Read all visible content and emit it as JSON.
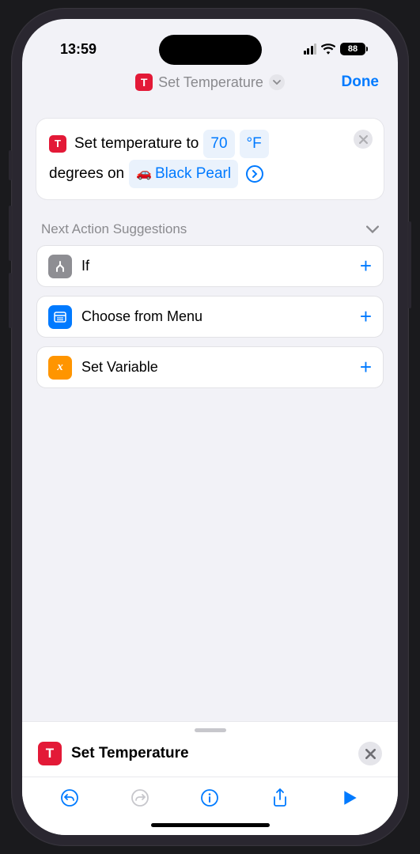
{
  "status": {
    "time": "13:59",
    "battery": "88"
  },
  "nav": {
    "title": "Set Temperature",
    "done": "Done"
  },
  "action": {
    "text_prefix": "Set temperature to",
    "temp_value": "70",
    "temp_unit": "°F",
    "degrees_on": "degrees on",
    "vehicle": "Black Pearl"
  },
  "suggestions_header": "Next Action Suggestions",
  "suggestions": [
    {
      "label": "If",
      "icon_color": "gray",
      "icon_glyph": "Y"
    },
    {
      "label": "Choose from Menu",
      "icon_color": "blue",
      "icon_glyph": "▤"
    },
    {
      "label": "Set Variable",
      "icon_color": "orange",
      "icon_glyph": "x"
    }
  ],
  "bottom": {
    "label": "Set Temperature"
  }
}
